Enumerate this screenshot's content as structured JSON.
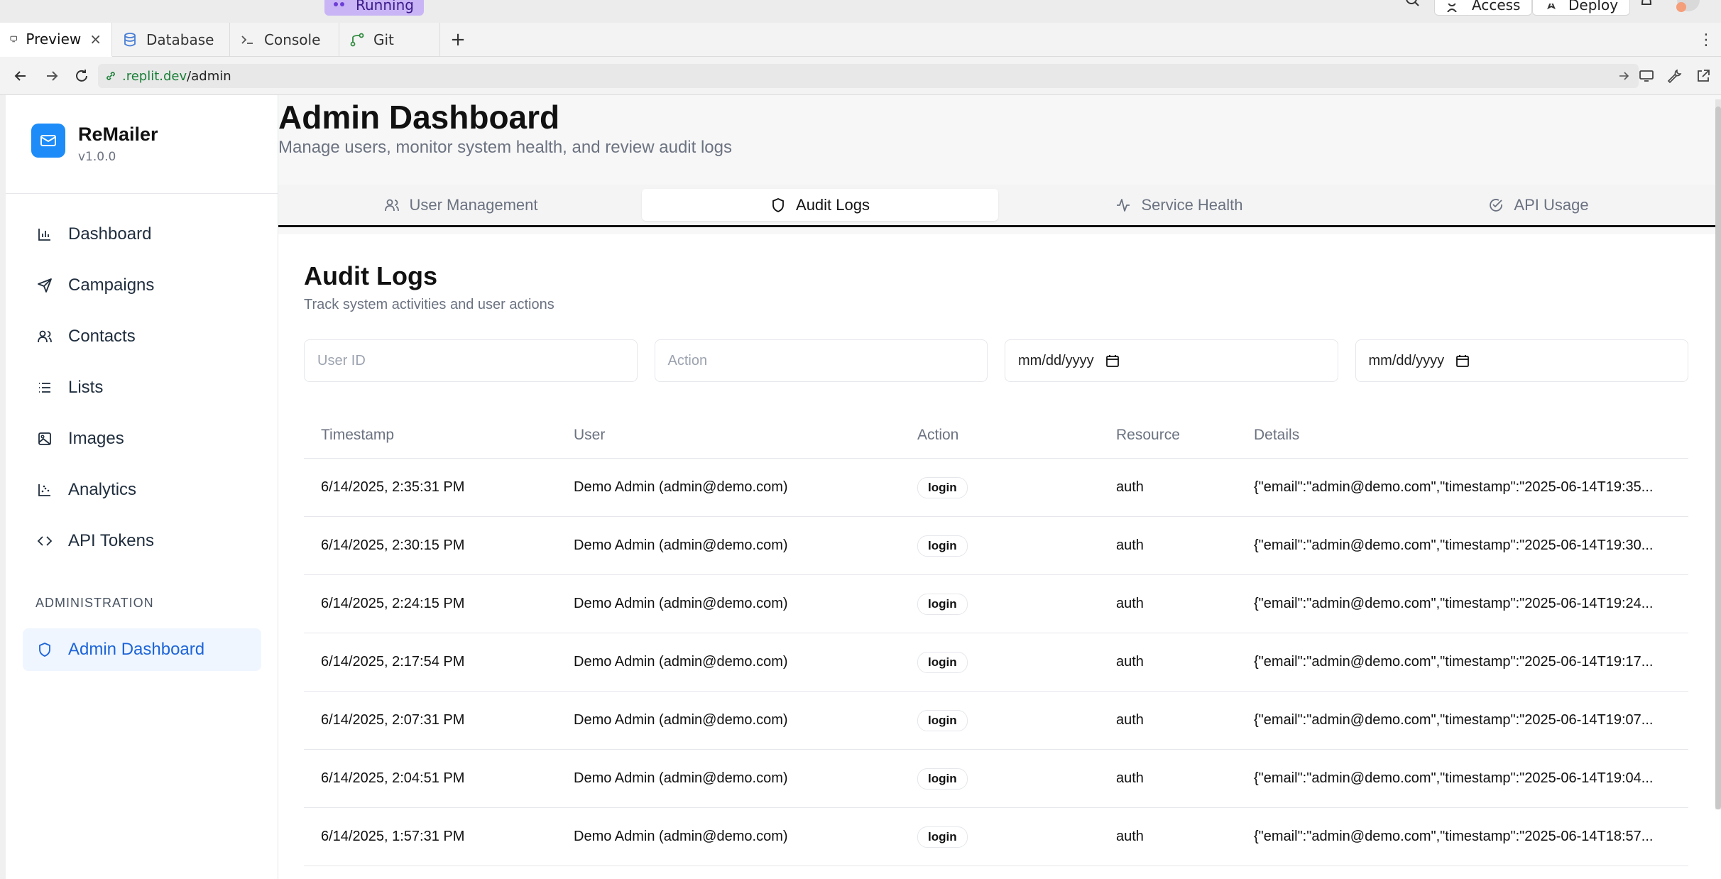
{
  "browser": {
    "run_badge": "Running",
    "access_label": "Access",
    "deploy_label": "Deploy",
    "tabs": [
      {
        "label": "Preview",
        "close": "×"
      },
      {
        "label": "Database"
      },
      {
        "label": "Console"
      },
      {
        "label": "Git"
      }
    ],
    "new_tab": "+",
    "menu_glyph": "⋮",
    "url_host": ".replit.dev",
    "url_path": "/admin"
  },
  "sidebar": {
    "brand_name": "ReMailer",
    "brand_version": "v1.0.0",
    "items": [
      {
        "label": "Dashboard",
        "icon": "bar-chart-icon"
      },
      {
        "label": "Campaigns",
        "icon": "send-icon"
      },
      {
        "label": "Contacts",
        "icon": "users-icon"
      },
      {
        "label": "Lists",
        "icon": "list-icon"
      },
      {
        "label": "Images",
        "icon": "image-icon"
      },
      {
        "label": "Analytics",
        "icon": "scatter-chart-icon"
      },
      {
        "label": "API Tokens",
        "icon": "code-icon"
      }
    ],
    "admin_section": "ADMINISTRATION",
    "admin_item": "Admin Dashboard",
    "accent_color": "#1d64d8"
  },
  "main": {
    "title": "Admin Dashboard",
    "subtitle": "Manage users, monitor system health, and review audit logs",
    "tabs": [
      {
        "label": "User Management",
        "icon": "users-icon"
      },
      {
        "label": "Audit Logs",
        "icon": "shield-icon",
        "active": true
      },
      {
        "label": "Service Health",
        "icon": "activity-icon"
      },
      {
        "label": "API Usage",
        "icon": "check-circle-icon"
      }
    ],
    "card_title": "Audit Logs",
    "card_subtitle": "Track system activities and user actions",
    "filters": {
      "user_id_placeholder": "User ID",
      "action_placeholder": "Action",
      "date_from": "mm/dd/yyyy",
      "date_to": "mm/dd/yyyy"
    },
    "table": {
      "headers": [
        "Timestamp",
        "User",
        "Action",
        "Resource",
        "Details"
      ],
      "rows": [
        {
          "timestamp": "6/14/2025, 2:35:31 PM",
          "user": "Demo Admin (admin@demo.com)",
          "action": "login",
          "resource": "auth",
          "details": "{\"email\":\"admin@demo.com\",\"timestamp\":\"2025-06-14T19:35..."
        },
        {
          "timestamp": "6/14/2025, 2:30:15 PM",
          "user": "Demo Admin (admin@demo.com)",
          "action": "login",
          "resource": "auth",
          "details": "{\"email\":\"admin@demo.com\",\"timestamp\":\"2025-06-14T19:30..."
        },
        {
          "timestamp": "6/14/2025, 2:24:15 PM",
          "user": "Demo Admin (admin@demo.com)",
          "action": "login",
          "resource": "auth",
          "details": "{\"email\":\"admin@demo.com\",\"timestamp\":\"2025-06-14T19:24..."
        },
        {
          "timestamp": "6/14/2025, 2:17:54 PM",
          "user": "Demo Admin (admin@demo.com)",
          "action": "login",
          "resource": "auth",
          "details": "{\"email\":\"admin@demo.com\",\"timestamp\":\"2025-06-14T19:17..."
        },
        {
          "timestamp": "6/14/2025, 2:07:31 PM",
          "user": "Demo Admin (admin@demo.com)",
          "action": "login",
          "resource": "auth",
          "details": "{\"email\":\"admin@demo.com\",\"timestamp\":\"2025-06-14T19:07..."
        },
        {
          "timestamp": "6/14/2025, 2:04:51 PM",
          "user": "Demo Admin (admin@demo.com)",
          "action": "login",
          "resource": "auth",
          "details": "{\"email\":\"admin@demo.com\",\"timestamp\":\"2025-06-14T19:04..."
        },
        {
          "timestamp": "6/14/2025, 1:57:31 PM",
          "user": "Demo Admin (admin@demo.com)",
          "action": "login",
          "resource": "auth",
          "details": "{\"email\":\"admin@demo.com\",\"timestamp\":\"2025-06-14T18:57..."
        }
      ]
    }
  }
}
